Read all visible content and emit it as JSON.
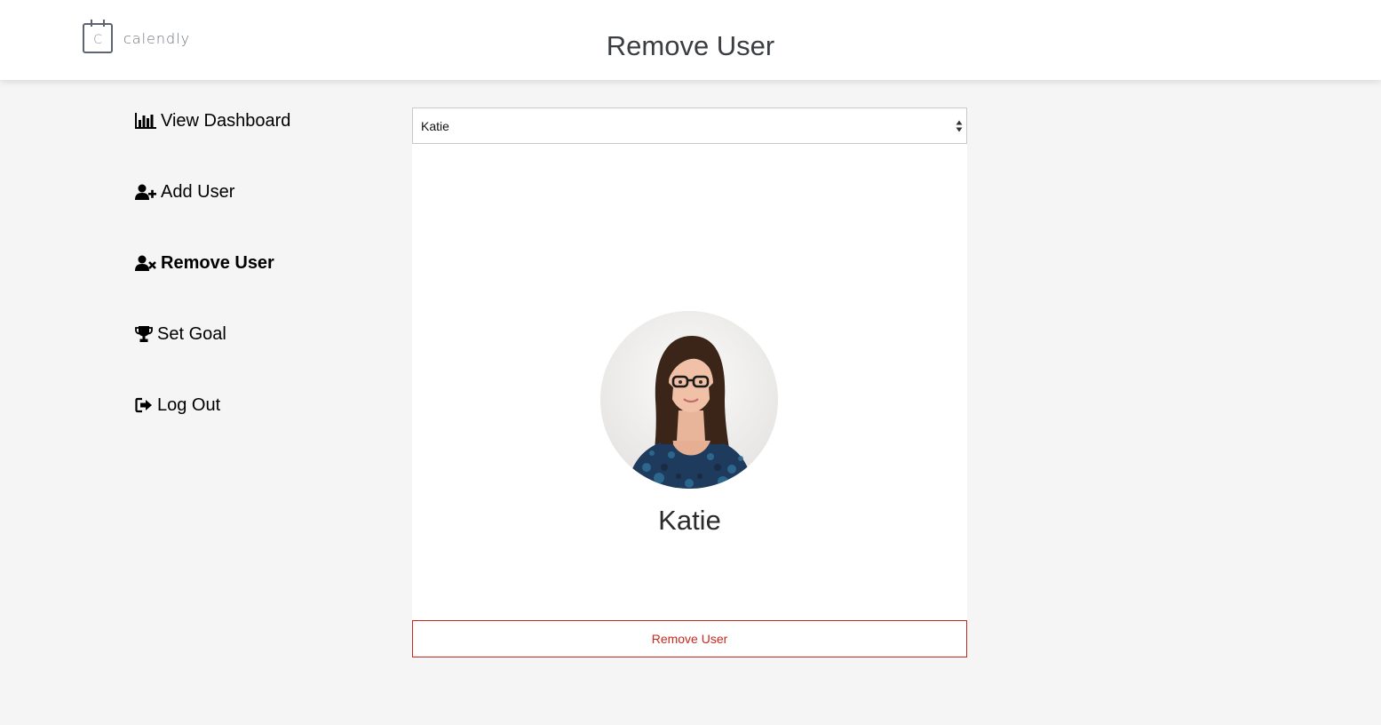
{
  "brand": {
    "name": "calendly",
    "logo_letter": "C"
  },
  "header": {
    "title": "Remove User"
  },
  "sidebar": {
    "items": [
      {
        "label": "View Dashboard",
        "icon": "bar-chart-icon",
        "active": false
      },
      {
        "label": "Add User",
        "icon": "user-plus-icon",
        "active": false
      },
      {
        "label": "Remove User",
        "icon": "user-times-icon",
        "active": true
      },
      {
        "label": "Set Goal",
        "icon": "trophy-icon",
        "active": false
      },
      {
        "label": "Log Out",
        "icon": "sign-out-icon",
        "active": false
      }
    ]
  },
  "user_select": {
    "selected": "Katie"
  },
  "profile": {
    "name": "Katie",
    "photo": "avatar-photo"
  },
  "actions": {
    "remove_label": "Remove User"
  },
  "colors": {
    "danger": "#c8281e",
    "background": "#f5f5f5",
    "panel": "#ffffff",
    "title_text": "#3a3d42"
  }
}
